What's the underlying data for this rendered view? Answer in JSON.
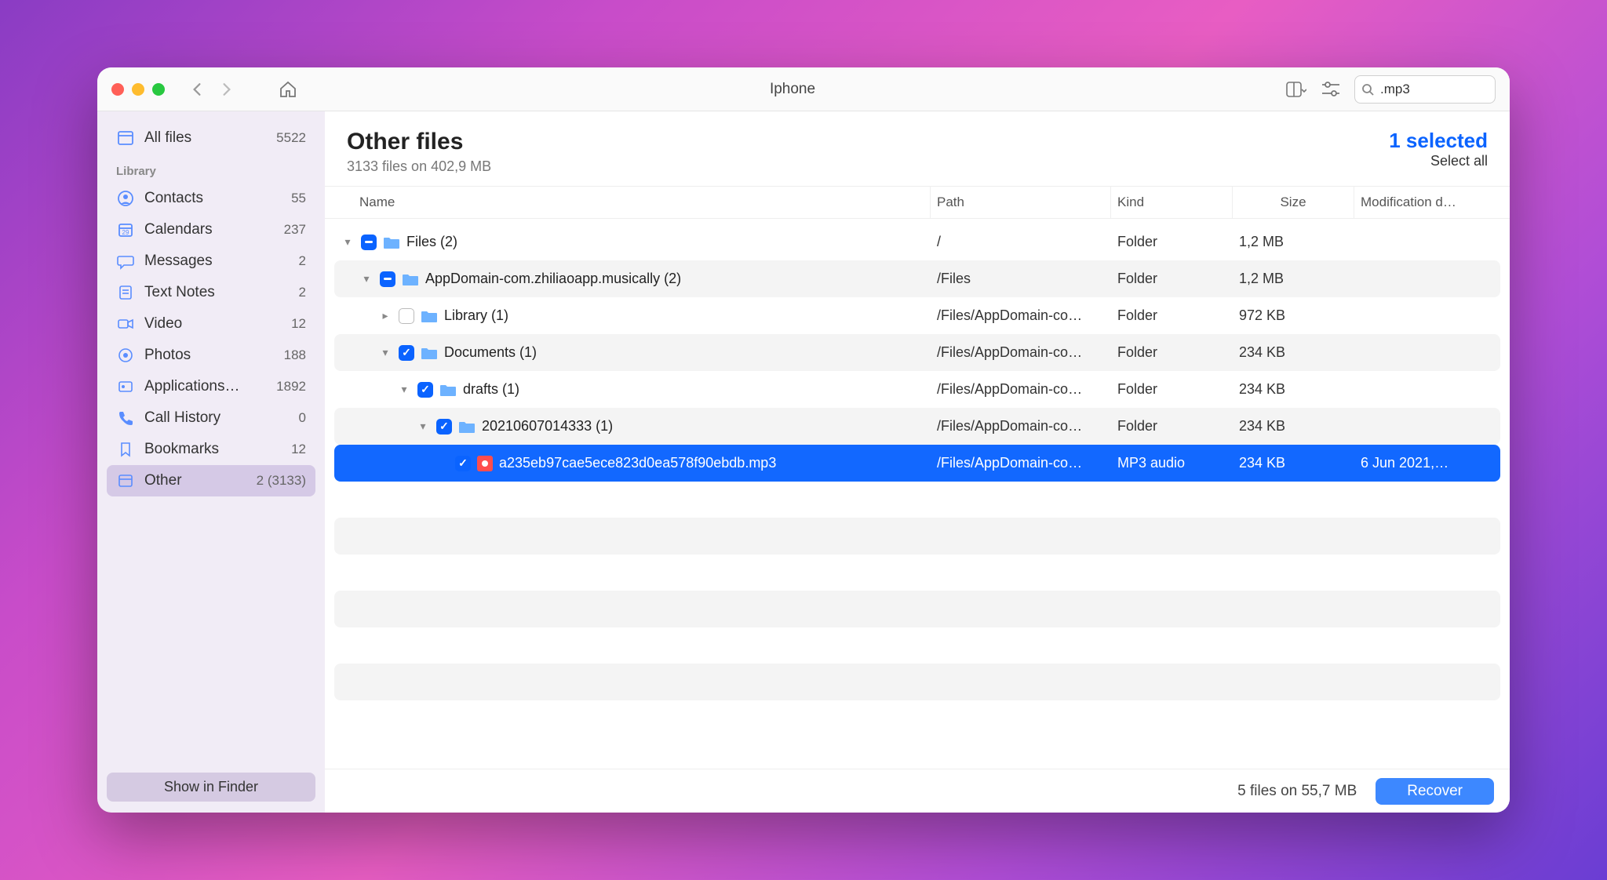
{
  "titlebar": {
    "title": "Iphone"
  },
  "search": {
    "value": ".mp3"
  },
  "sidebar": {
    "all_files": {
      "label": "All files",
      "count": "5522"
    },
    "section": "Library",
    "items": [
      {
        "label": "Contacts",
        "count": "55"
      },
      {
        "label": "Calendars",
        "count": "237"
      },
      {
        "label": "Messages",
        "count": "2"
      },
      {
        "label": "Text Notes",
        "count": "2"
      },
      {
        "label": "Video",
        "count": "12"
      },
      {
        "label": "Photos",
        "count": "188"
      },
      {
        "label": "Applications…",
        "count": "1892"
      },
      {
        "label": "Call History",
        "count": "0"
      },
      {
        "label": "Bookmarks",
        "count": "12"
      },
      {
        "label": "Other",
        "count": "2 (3133)"
      }
    ],
    "show_in_finder": "Show in Finder"
  },
  "header": {
    "title": "Other files",
    "subtitle": "3133 files on 402,9 MB",
    "selected": "1 selected",
    "select_all": "Select all"
  },
  "columns": {
    "name": "Name",
    "path": "Path",
    "kind": "Kind",
    "size": "Size",
    "mod": "Modification d…"
  },
  "rows": [
    {
      "indent": 0,
      "expand": "down",
      "check": "mixed",
      "icon": "folder",
      "name": "Files (2)",
      "path": "/",
      "kind": "Folder",
      "size": "1,2 MB",
      "mod": ""
    },
    {
      "indent": 1,
      "expand": "down",
      "check": "mixed",
      "icon": "folder",
      "name": "AppDomain-com.zhiliaoapp.musically (2)",
      "path": "/Files",
      "kind": "Folder",
      "size": "1,2 MB",
      "mod": ""
    },
    {
      "indent": 2,
      "expand": "right",
      "check": "none",
      "icon": "folder",
      "name": "Library (1)",
      "path": "/Files/AppDomain-co…",
      "kind": "Folder",
      "size": "972 KB",
      "mod": ""
    },
    {
      "indent": 2,
      "expand": "down",
      "check": "checked",
      "icon": "folder",
      "name": "Documents (1)",
      "path": "/Files/AppDomain-co…",
      "kind": "Folder",
      "size": "234 KB",
      "mod": ""
    },
    {
      "indent": 3,
      "expand": "down",
      "check": "checked",
      "icon": "folder",
      "name": "drafts (1)",
      "path": "/Files/AppDomain-co…",
      "kind": "Folder",
      "size": "234 KB",
      "mod": ""
    },
    {
      "indent": 4,
      "expand": "down",
      "check": "checked",
      "icon": "folder",
      "name": "20210607014333 (1)",
      "path": "/Files/AppDomain-co…",
      "kind": "Folder",
      "size": "234 KB",
      "mod": ""
    },
    {
      "indent": 5,
      "expand": "",
      "check": "checked",
      "icon": "file",
      "name": "a235eb97cae5ece823d0ea578f90ebdb.mp3",
      "path": "/Files/AppDomain-co…",
      "kind": "MP3 audio",
      "size": "234 KB",
      "mod": "6 Jun 2021,…",
      "selected": true
    }
  ],
  "footer": {
    "stat": "5 files on 55,7 MB",
    "recover": "Recover"
  }
}
